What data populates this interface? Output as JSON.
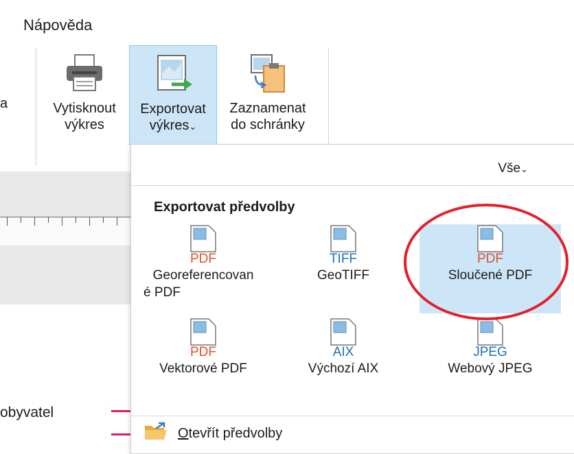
{
  "menu": {
    "help": "Nápověda",
    "partial_left": "a"
  },
  "ribbon": {
    "print": {
      "line1": "Vytisknout",
      "line2": "výkres"
    },
    "export": {
      "line1": "Exportovat",
      "line2": "výkres",
      "chevron": "⌄"
    },
    "clipboard": {
      "line1": "Zaznamenat",
      "line2": "do schránky"
    }
  },
  "panel": {
    "filter": "Vše",
    "filter_chevron": "⌄",
    "section_title": "Exportovat předvolby",
    "tiles": [
      {
        "format": "PDF",
        "format_color": "#d9542c",
        "caption1": "Georeferencovan",
        "caption2": "é PDF"
      },
      {
        "format": "TIFF",
        "format_color": "#1f6fb5",
        "caption1": "GeoTIFF",
        "caption2": ""
      },
      {
        "format": "PDF",
        "format_color": "#d9542c",
        "caption1": "Sloučené PDF",
        "caption2": "",
        "selected": true
      },
      {
        "format": "PDF",
        "format_color": "#d9542c",
        "caption1": "Vektorové PDF",
        "caption2": ""
      },
      {
        "format": "AIX",
        "format_color": "#1f6fb5",
        "caption1": "Výchozí AIX",
        "caption2": ""
      },
      {
        "format": "JPEG",
        "format_color": "#1f6fb5",
        "caption1": "Webový JPEG",
        "caption2": ""
      }
    ],
    "open_prefs_first": "O",
    "open_prefs_rest": "tevřít předvolby"
  },
  "background": {
    "legend_label": "obyvatel",
    "legend_color": "#e0196b"
  },
  "colors": {
    "selected_bg": "#cde6f7",
    "annotation": "#e3202b"
  }
}
